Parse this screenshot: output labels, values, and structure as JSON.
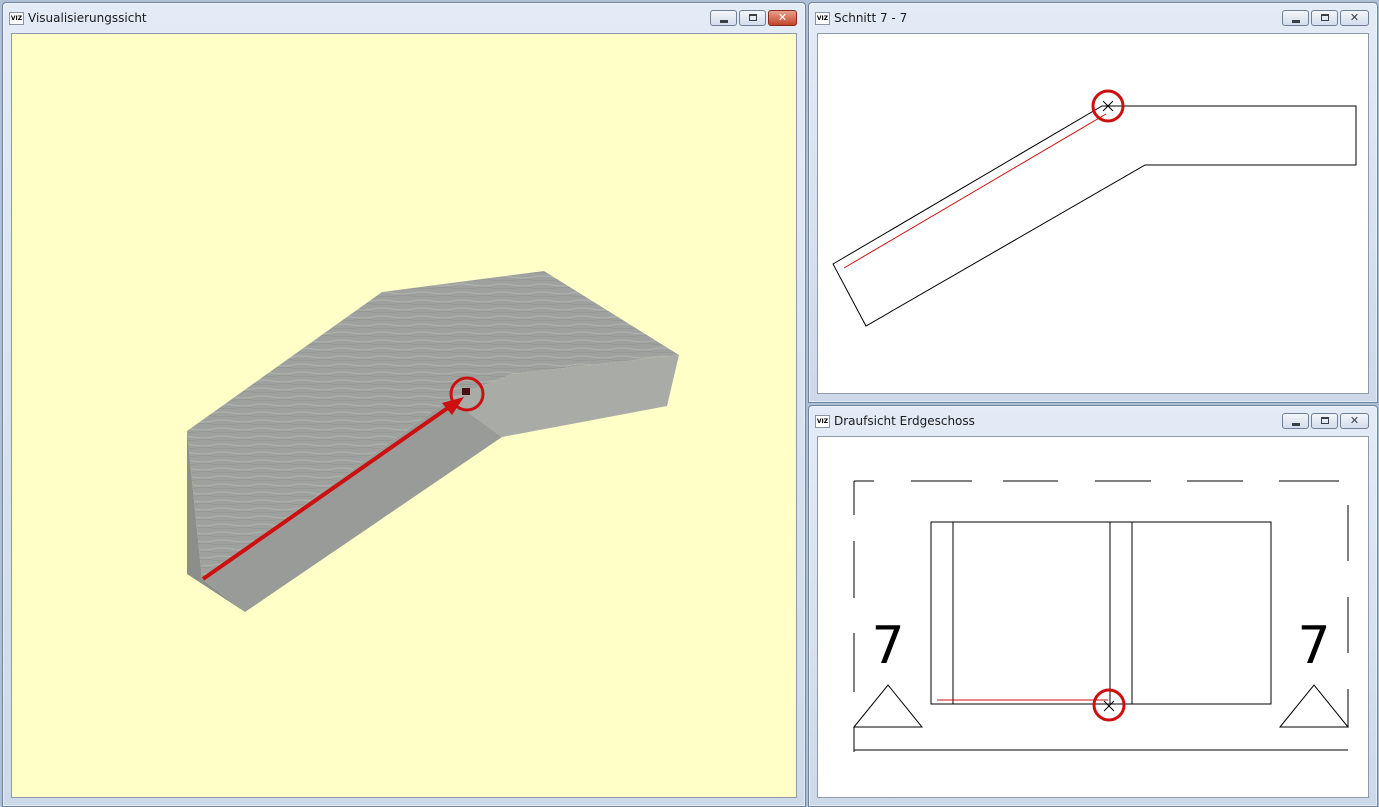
{
  "windows": {
    "visualization": {
      "title": "Visualisierungssicht",
      "background": "#ffffc8",
      "icon": "app-logo-icon"
    },
    "section": {
      "title": "Schnitt 7 - 7",
      "background": "#ffffff",
      "icon": "app-logo-icon"
    },
    "plan": {
      "title": "Draufsicht Erdgeschoss",
      "background": "#ffffff",
      "icon": "app-logo-icon"
    }
  },
  "plan_labels": {
    "left_section_mark": "7",
    "right_section_mark": "7"
  },
  "colors": {
    "highlight_red": "#cc1010",
    "slab_gray": "#9a9c99"
  }
}
